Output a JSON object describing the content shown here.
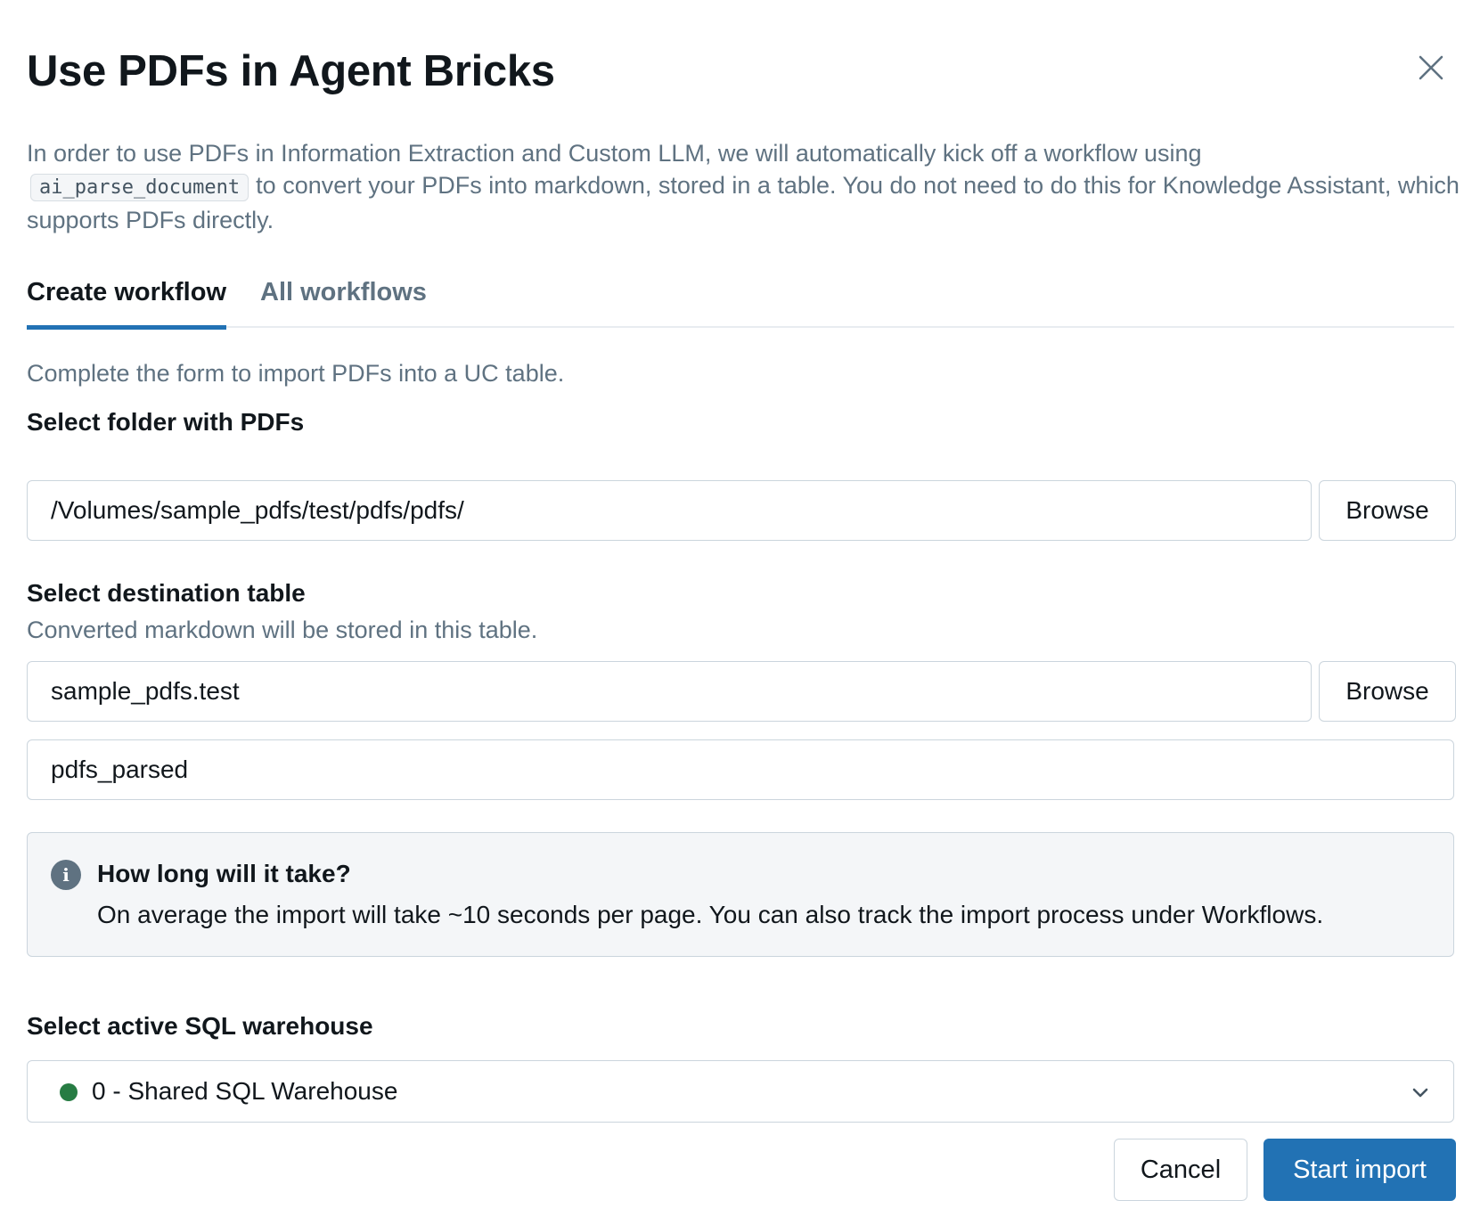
{
  "dialog": {
    "title": "Use PDFs in Agent Bricks",
    "close_icon": "close-icon"
  },
  "description": {
    "part1": "In order to use PDFs in Information Extraction and Custom LLM, we will automatically kick off a workflow using",
    "code": "ai_parse_document",
    "part2": "to convert your PDFs into markdown, stored in a table. You do not need to do this for Knowledge Assistant, which supports PDFs directly."
  },
  "tabs": [
    {
      "label": "Create workflow",
      "active": true
    },
    {
      "label": "All workflows",
      "active": false
    }
  ],
  "form": {
    "intro": "Complete the form to import PDFs into a UC table.",
    "folder": {
      "label": "Select folder with PDFs",
      "value": "/Volumes/sample_pdfs/test/pdfs/pdfs/",
      "browse_label": "Browse"
    },
    "destination": {
      "label": "Select destination table",
      "sublabel": "Converted markdown will be stored in this table.",
      "schema_value": "sample_pdfs.test",
      "browse_label": "Browse",
      "table_value": "pdfs_parsed"
    },
    "info": {
      "icon": "info-icon",
      "icon_glyph": "i",
      "title": "How long will it take?",
      "body": "On average the import will take ~10 seconds per page. You can also track the import process under Workflows."
    },
    "warehouse": {
      "label": "Select active SQL warehouse",
      "selected": "0 - Shared SQL Warehouse",
      "status_color": "#277c43"
    }
  },
  "footer": {
    "cancel_label": "Cancel",
    "submit_label": "Start import"
  },
  "colors": {
    "primary": "#2272b4",
    "muted_text": "#5f7281",
    "border": "#cbd5dd"
  }
}
